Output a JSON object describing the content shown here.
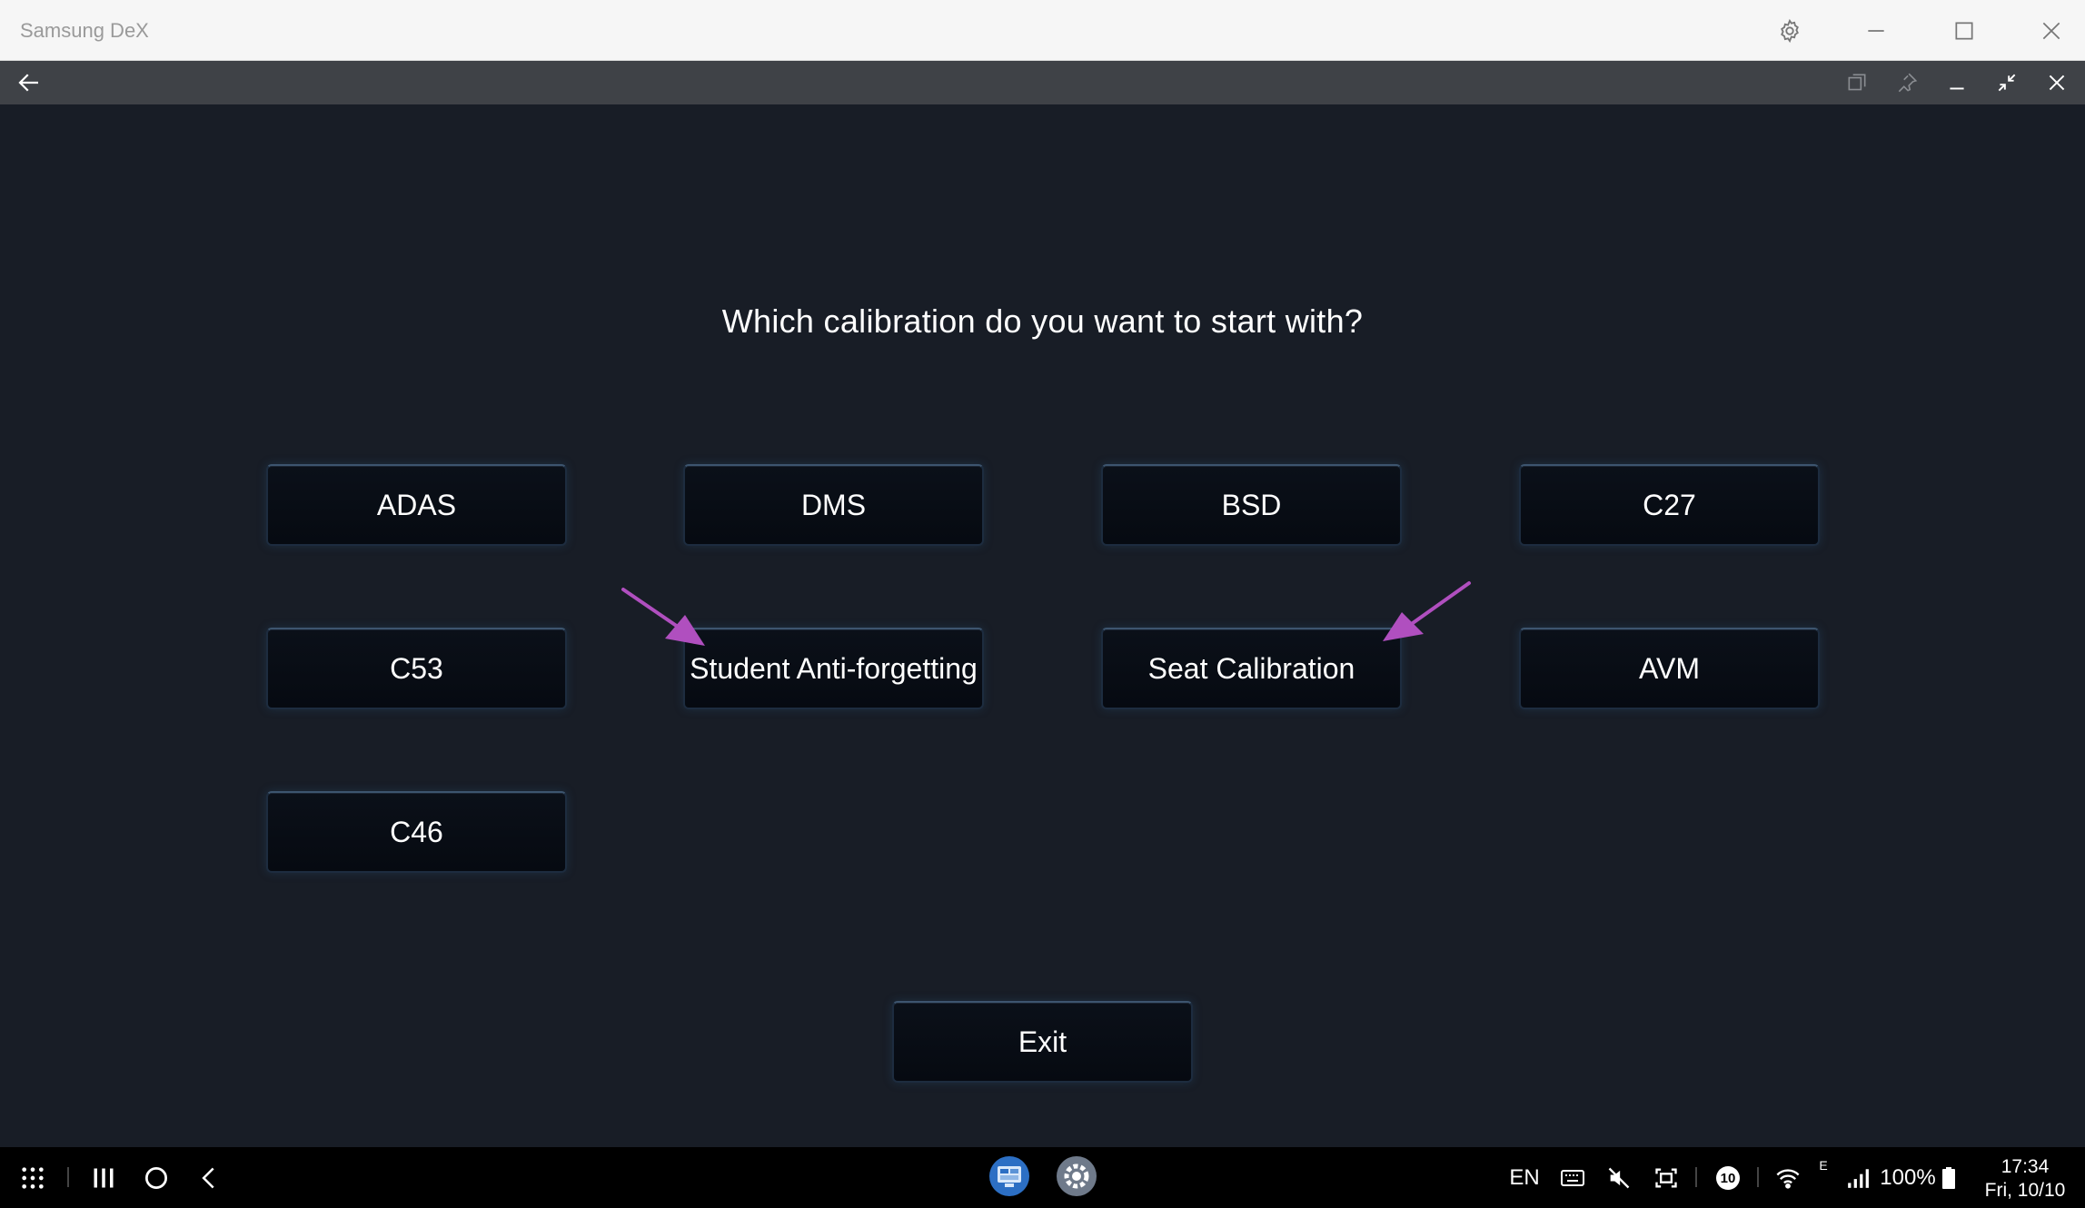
{
  "window": {
    "title": "Samsung DeX"
  },
  "main": {
    "question": "Which calibration do you want to start with?",
    "buttons": [
      {
        "label": "ADAS"
      },
      {
        "label": "DMS"
      },
      {
        "label": "BSD"
      },
      {
        "label": "C27"
      },
      {
        "label": "C53"
      },
      {
        "label": "Student Anti-forgetting"
      },
      {
        "label": "Seat Calibration"
      },
      {
        "label": "AVM"
      },
      {
        "label": "C46"
      }
    ],
    "exit_label": "Exit"
  },
  "annotations": {
    "arrow_color": "#b04fbf"
  },
  "taskbar": {
    "language": "EN",
    "notification_count": "10",
    "network_type": "E",
    "battery": "100%",
    "time": "17:34",
    "date": "Fri, 10/10"
  },
  "colors": {
    "background": "#181d26",
    "button_bg": "#0b1019",
    "button_border": "#3d556f",
    "titlebar": "#f6f6f6",
    "appbar": "#3f4247",
    "taskbar": "#000000"
  }
}
